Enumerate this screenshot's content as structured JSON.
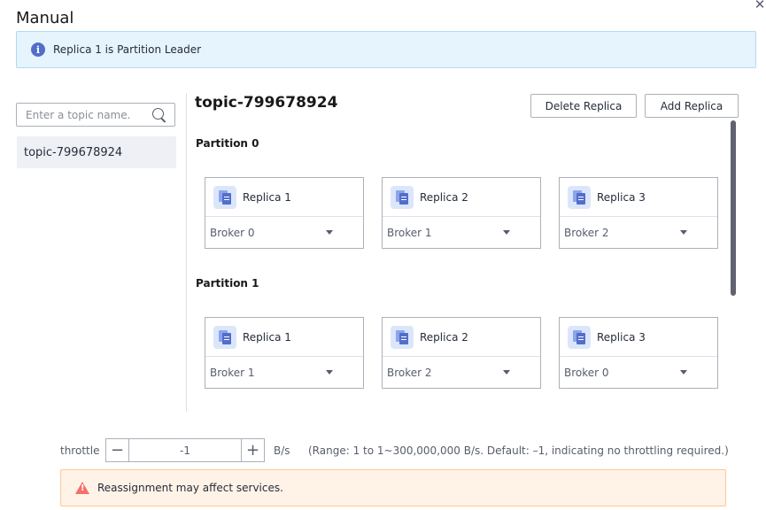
{
  "dialog": {
    "title": "Manual",
    "close_icon": "close-icon"
  },
  "info_banner": {
    "icon": "info-icon",
    "text": "Replica 1 is Partition Leader",
    "bg_color": "#e6f4fd"
  },
  "sidebar": {
    "search_placeholder": "Enter a topic name.",
    "search_value": "",
    "topics": [
      {
        "label": "topic-799678924",
        "selected": true
      }
    ]
  },
  "main": {
    "topic_title": "topic-799678924",
    "delete_replica_label": "Delete Replica",
    "add_replica_label": "Add Replica",
    "partitions": [
      {
        "label": "Partition 0",
        "replicas": [
          {
            "name": "Replica 1",
            "broker": "Broker 0"
          },
          {
            "name": "Replica 2",
            "broker": "Broker 1"
          },
          {
            "name": "Replica 3",
            "broker": "Broker 2"
          }
        ]
      },
      {
        "label": "Partition 1",
        "replicas": [
          {
            "name": "Replica 1",
            "broker": "Broker 1"
          },
          {
            "name": "Replica 2",
            "broker": "Broker 2"
          },
          {
            "name": "Replica 3",
            "broker": "Broker 0"
          }
        ]
      }
    ]
  },
  "throttle": {
    "label": "throttle",
    "value": "-1",
    "minus": "−",
    "plus": "+",
    "unit": "B/s",
    "hint": "(Range: 1 to 1~300,000,000 B/s. Default: –1, indicating no throttling required.)"
  },
  "warning_banner": {
    "icon": "warning-icon",
    "text": "Reassignment may affect services.",
    "bg_color": "#fff3e8"
  }
}
